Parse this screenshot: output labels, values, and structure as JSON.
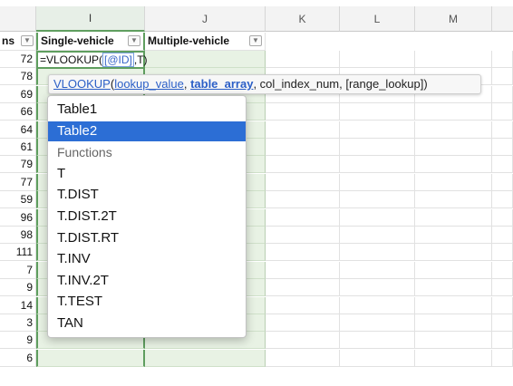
{
  "columns": {
    "H_partial": "ns",
    "I": "I",
    "J": "J",
    "K": "K",
    "L": "L",
    "M": "M"
  },
  "table_headers": {
    "single_vehicle": "Single-vehicle",
    "multiple_vehicle": "Multiple-vehicle",
    "dropdown_glyph": "▼"
  },
  "formula": {
    "prefix": "=VLOOKUP(",
    "ref": "[@ID]",
    "suffix": ",T)"
  },
  "column_h_values": [
    "72",
    "78",
    "69",
    "66",
    "64",
    "61",
    "79",
    "77",
    "59",
    "96",
    "98",
    "111",
    "7",
    "9",
    "14",
    "3",
    "9",
    "6"
  ],
  "tooltip": {
    "function": "VLOOKUP",
    "open": "(",
    "arg1": "lookup_value",
    "sep1": ", ",
    "arg2": "table_array",
    "rest": ", col_index_num, [range_lookup])"
  },
  "autocomplete": {
    "selected_index": 1,
    "items": [
      {
        "label": "Table1",
        "kind": "item"
      },
      {
        "label": "Table2",
        "kind": "item"
      },
      {
        "label": "Functions",
        "kind": "section"
      },
      {
        "label": "T",
        "kind": "item"
      },
      {
        "label": "T.DIST",
        "kind": "item"
      },
      {
        "label": "T.DIST.2T",
        "kind": "item"
      },
      {
        "label": "T.DIST.RT",
        "kind": "item"
      },
      {
        "label": "T.INV",
        "kind": "item"
      },
      {
        "label": "T.INV.2T",
        "kind": "item"
      },
      {
        "label": "T.TEST",
        "kind": "item"
      },
      {
        "label": "TAN",
        "kind": "item"
      }
    ]
  },
  "colors": {
    "selection_green": "#5f9e5f",
    "table_fill": "#e8f2e4",
    "highlight_blue": "#2c6ed5",
    "link_blue": "#2b5fc7"
  }
}
